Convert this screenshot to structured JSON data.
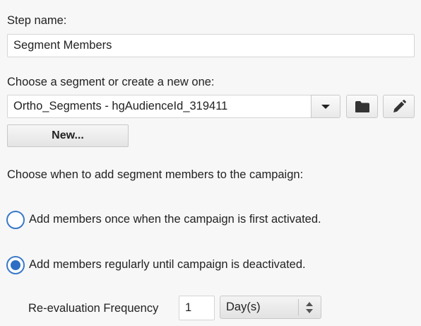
{
  "step": {
    "label": "Step name:",
    "value": "Segment Members"
  },
  "segment": {
    "label": "Choose a segment or create a new one:",
    "selected": "Ortho_Segments - hgAudienceId_319411",
    "dropdown_icon": "caret-down-icon",
    "browse_icon": "folder-icon",
    "edit_icon": "pencil-icon",
    "new_label": "New..."
  },
  "timing": {
    "label": "Choose when to add segment members to the campaign:",
    "options": [
      {
        "label": "Add members once when the campaign is first activated.",
        "selected": false
      },
      {
        "label": "Add members regularly until campaign is deactivated.",
        "selected": true
      }
    ]
  },
  "frequency": {
    "label": "Re-evaluation Frequency",
    "value": "1",
    "unit": "Day(s)",
    "stepper_icon": "up-down-arrows-icon"
  },
  "colors": {
    "accent": "#2e6fc4",
    "background": "#f7f7f7"
  }
}
